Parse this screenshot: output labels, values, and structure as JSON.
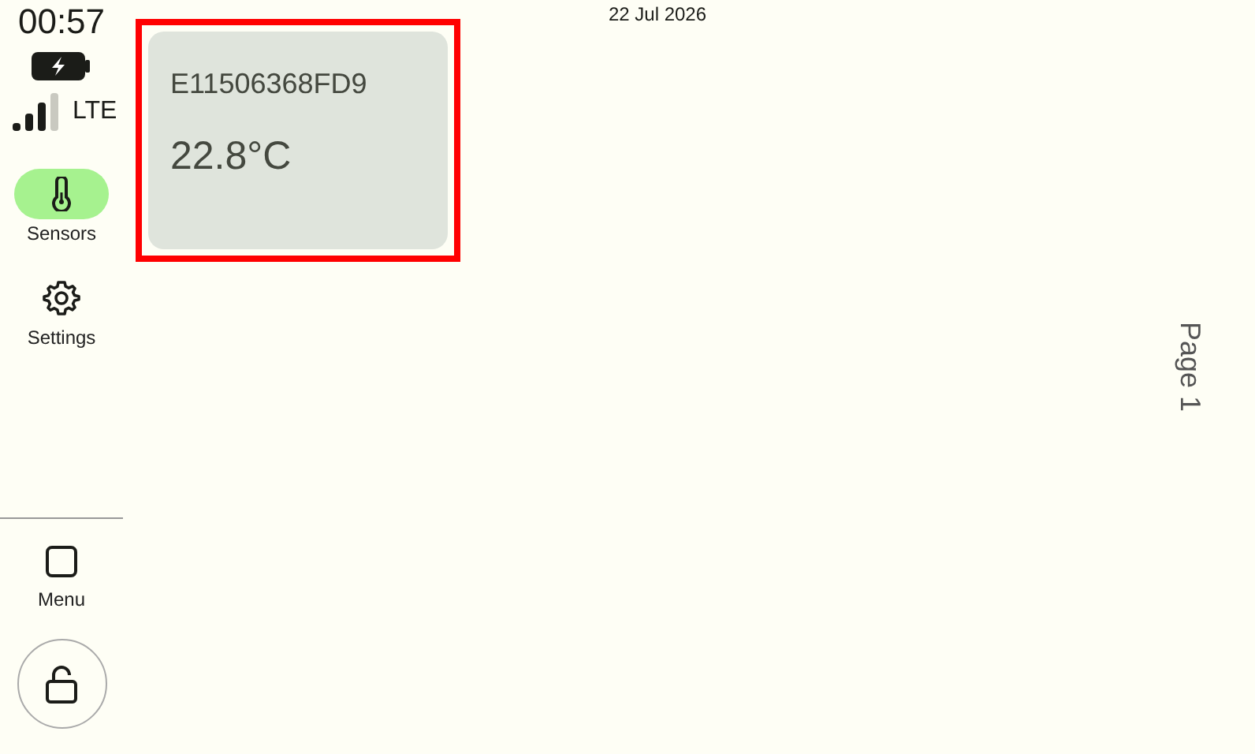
{
  "status": {
    "time": "00:57",
    "network": "LTE"
  },
  "nav": [
    {
      "label": "Sensors",
      "kind": "thermometer",
      "selected": true
    },
    {
      "label": "Settings",
      "kind": "gear",
      "selected": false
    }
  ],
  "bottom_nav": [
    {
      "label": "Menu",
      "kind": "square"
    }
  ],
  "lock": {
    "locked": false
  },
  "date": "22 Jul 2026",
  "sensors": [
    {
      "id": "E11506368FD9",
      "reading": "22.8°C",
      "selected": true
    }
  ],
  "page_label": "Page 1"
}
